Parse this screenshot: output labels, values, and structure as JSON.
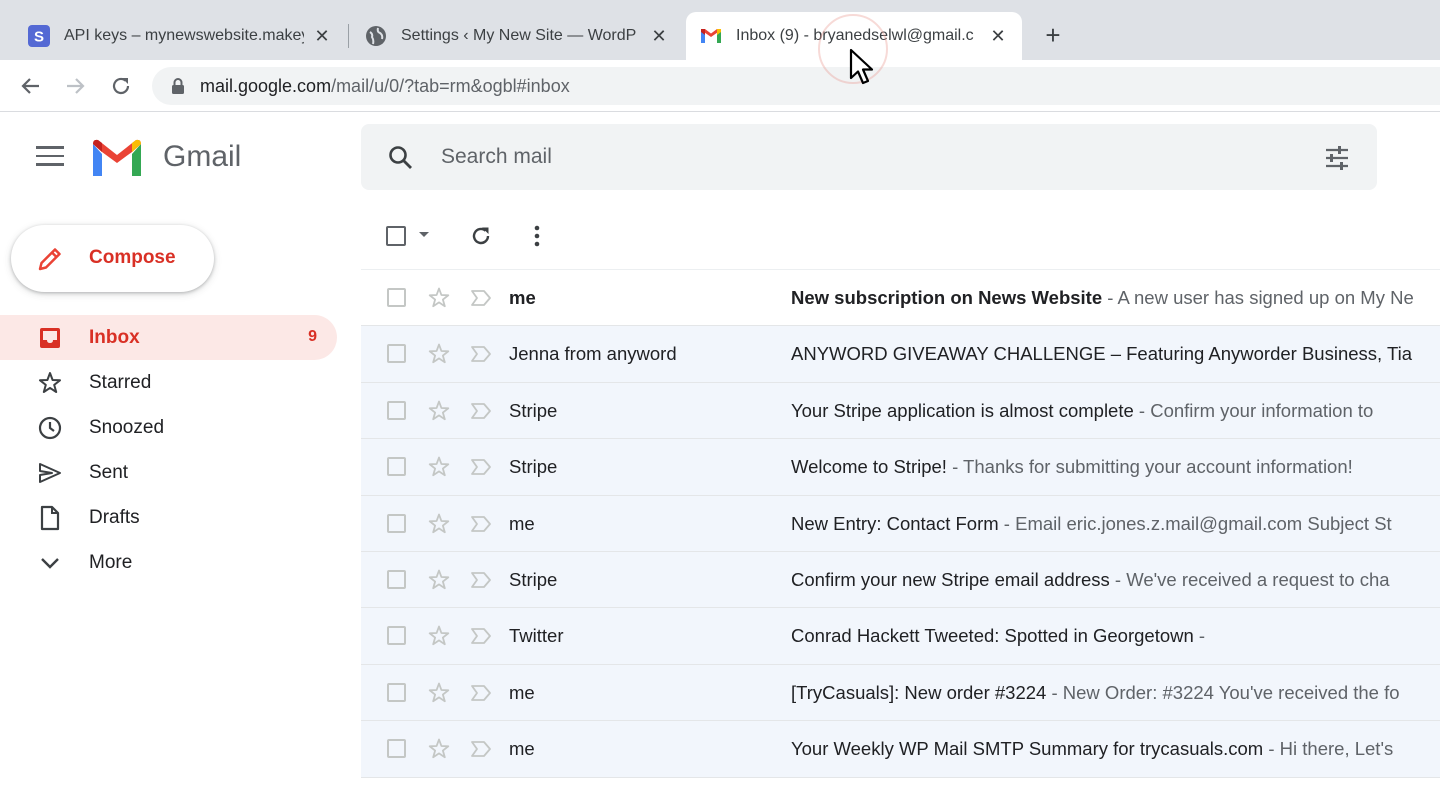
{
  "browser": {
    "tabs": [
      {
        "title": "API keys – mynewswebsite.makey",
        "favicon": "stripe-s-icon"
      },
      {
        "title": "Settings ‹ My New Site — WordP",
        "favicon": "globe-icon"
      },
      {
        "title": "Inbox (9) - bryanedselwl@gmail.c",
        "favicon": "gmail-icon",
        "active": true
      }
    ],
    "close_glyph": "✕",
    "newtab_glyph": "+",
    "url_host": "mail.google.com",
    "url_path": "/mail/u/0/?tab=rm&ogbl#inbox"
  },
  "header": {
    "brand": "Gmail",
    "search_placeholder": "Search mail"
  },
  "sidebar": {
    "compose_label": "Compose",
    "items": [
      {
        "label": "Inbox",
        "count": "9",
        "icon": "inbox-icon",
        "active": true
      },
      {
        "label": "Starred",
        "count": "",
        "icon": "star-icon"
      },
      {
        "label": "Snoozed",
        "count": "",
        "icon": "clock-icon"
      },
      {
        "label": "Sent",
        "count": "",
        "icon": "send-icon"
      },
      {
        "label": "Drafts",
        "count": "",
        "icon": "draft-icon"
      },
      {
        "label": "More",
        "count": "",
        "icon": "chevron-down-icon"
      }
    ]
  },
  "mails": [
    {
      "sender": "me",
      "subject": "New subscription on News Website",
      "snippet": " - A new user has signed up on My Ne",
      "unread": true
    },
    {
      "sender": "Jenna from anyword",
      "subject": "ANYWORD GIVEAWAY CHALLENGE – Featuring Anyworder Business, Tia",
      "snippet": "",
      "unread": false
    },
    {
      "sender": "Stripe",
      "subject": "Your Stripe application is almost complete",
      "snippet": " - Confirm your information to",
      "unread": false
    },
    {
      "sender": "Stripe",
      "subject": "Welcome to Stripe!",
      "snippet": " - Thanks for submitting your account information!",
      "unread": false
    },
    {
      "sender": "me",
      "subject": "New Entry: Contact Form",
      "snippet": " - Email eric.jones.z.mail@gmail.com Subject St",
      "unread": false
    },
    {
      "sender": "Stripe",
      "subject": "Confirm your new Stripe email address",
      "snippet": " - We've received a request to cha",
      "unread": false
    },
    {
      "sender": "Twitter",
      "subject": "Conrad Hackett Tweeted: Spotted in Georgetown",
      "snippet": " -",
      "unread": false
    },
    {
      "sender": "me",
      "subject": "[TryCasuals]: New order #3224",
      "snippet": " - New Order: #3224 You've received the fo",
      "unread": false
    },
    {
      "sender": "me",
      "subject": "Your Weekly WP Mail SMTP Summary for trycasuals.com",
      "snippet": " - Hi there, Let's",
      "unread": false
    }
  ],
  "colors": {
    "accent": "#d93025",
    "active_bg": "#fce8e6",
    "read_row_bg": "#f2f6fc"
  }
}
